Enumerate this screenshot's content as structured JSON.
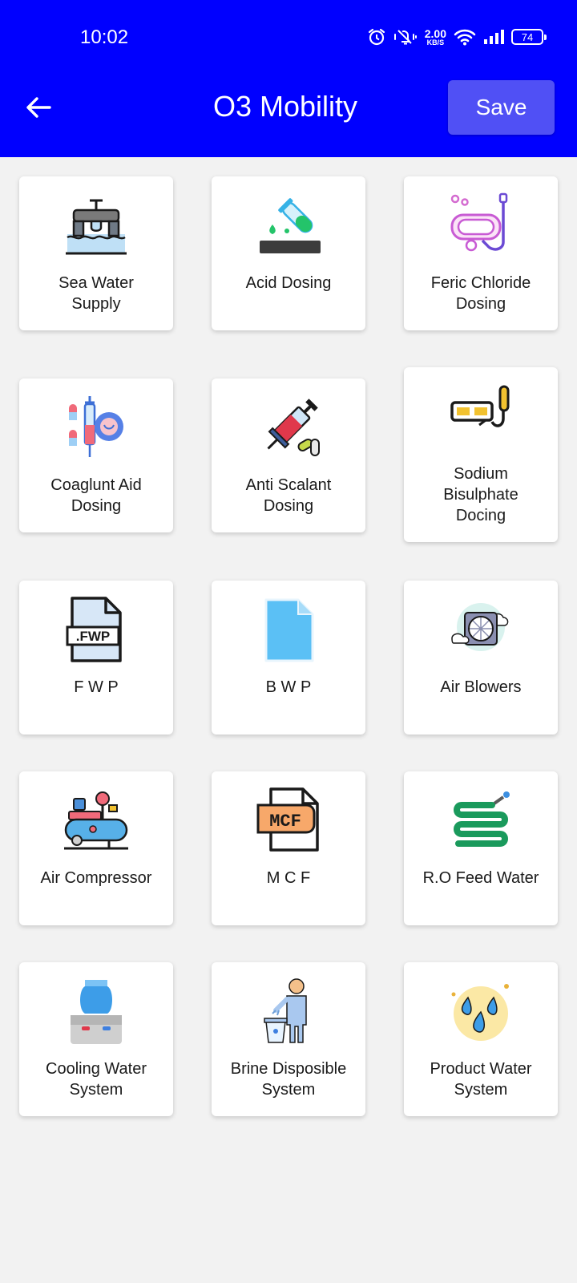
{
  "status_bar": {
    "time": "10:02",
    "speed_value": "2.00",
    "speed_unit": "KB/S",
    "battery": "74"
  },
  "header": {
    "title": "O3 Mobility",
    "save_label": "Save"
  },
  "colors": {
    "header_bg": "#0000ff",
    "save_bg": "#5050f5",
    "page_bg": "#f2f2f2"
  },
  "tiles": [
    {
      "line1": "Sea Water",
      "line2": "Supply",
      "line3": "",
      "icon": "water-tap-icon"
    },
    {
      "line1": "Acid Dosing",
      "line2": "",
      "line3": "",
      "icon": "test-tube-icon"
    },
    {
      "line1": "Feric Chloride",
      "line2": "Dosing",
      "line3": "",
      "icon": "snorkel-mask-icon"
    },
    {
      "line1": "Coaglunt Aid",
      "line2": "Dosing",
      "line3": "",
      "icon": "syringe-pills-icon"
    },
    {
      "line1": "Anti Scalant",
      "line2": "Dosing",
      "line3": "",
      "icon": "syringe-icon"
    },
    {
      "line1": "Sodium",
      "line2": "Bisulphate",
      "line3": "Docing",
      "icon": "goggles-snorkel-icon"
    },
    {
      "line1": "F W P",
      "line2": "",
      "line3": "",
      "icon": "fwp-file-icon"
    },
    {
      "line1": "B W P",
      "line2": "",
      "line3": "",
      "icon": "blue-file-icon"
    },
    {
      "line1": "Air Blowers",
      "line2": "",
      "line3": "",
      "icon": "fan-clouds-icon"
    },
    {
      "line1": "Air Compressor",
      "line2": "",
      "line3": "",
      "icon": "air-compressor-icon"
    },
    {
      "line1": "M C F",
      "line2": "",
      "line3": "",
      "icon": "mcf-file-icon"
    },
    {
      "line1": "R.O Feed Water",
      "line2": "",
      "line3": "",
      "icon": "hose-icon"
    },
    {
      "line1": "Cooling Water",
      "line2": "System",
      "line3": "",
      "icon": "water-cooler-icon"
    },
    {
      "line1": "Brine Disposible",
      "line2": "System",
      "line3": "",
      "icon": "person-trash-icon"
    },
    {
      "line1": "Product Water",
      "line2": "System",
      "line3": "",
      "icon": "water-drops-icon"
    }
  ]
}
